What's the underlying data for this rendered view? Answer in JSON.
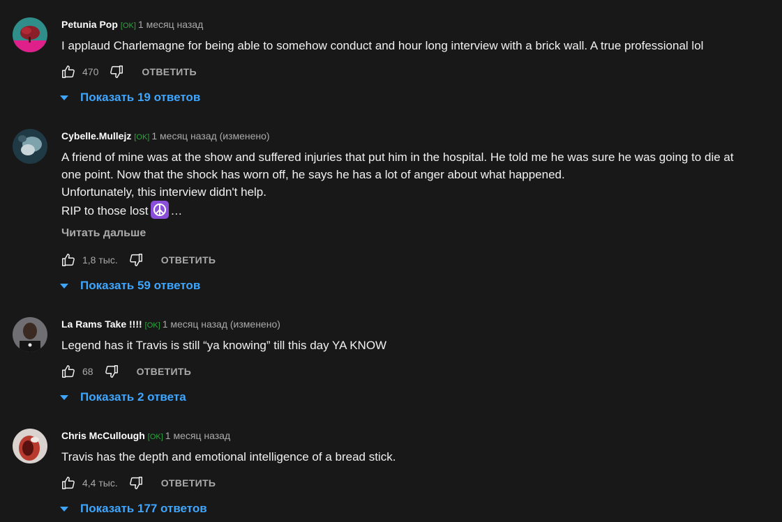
{
  "colors": {
    "background": "#181818",
    "text_primary": "#f1f1f1",
    "text_secondary": "#aaaaaa",
    "link_blue": "#3ea6ff",
    "badge_green": "#2ba640"
  },
  "icons": {
    "like": "thumb-up-icon",
    "dislike": "thumb-down-icon",
    "expand": "caret-down-icon",
    "emoji": "peace-symbol-emoji"
  },
  "comments": [
    {
      "author": "Petunia Pop",
      "badge": "[OK]",
      "timestamp": "1 месяц назад",
      "lines": [
        "I applaud Charlemagne for being able to somehow conduct and hour long interview with a brick wall. A true professional lol"
      ],
      "likes": "470",
      "reply_label": "ОТВЕТИТЬ",
      "show_replies": "Показать 19 ответов"
    },
    {
      "author": "Cybelle.Mullejz",
      "badge": "[OK]",
      "timestamp": "1 месяц назад (изменено)",
      "lines": [
        "A friend of mine was at the show and suffered injuries that put him in the hospital. He told me he was sure he was going to die at",
        "one point. Now that the shock has worn off, he says he has a lot of anger about what happened.",
        "Unfortunately, this interview didn't help.",
        "RIP to those lost"
      ],
      "ellipsis": "…",
      "read_more": "Читать дальше",
      "likes": "1,8 тыс.",
      "reply_label": "ОТВЕТИТЬ",
      "show_replies": "Показать 59 ответов"
    },
    {
      "author": "La Rams Take !!!!",
      "badge": "[OK]",
      "timestamp": "1 месяц назад (изменено)",
      "lines": [
        "Legend has it Travis is still “ya knowing” till this day YA KNOW"
      ],
      "likes": "68",
      "reply_label": "ОТВЕТИТЬ",
      "show_replies": "Показать 2 ответа"
    },
    {
      "author": "Chris McCullough",
      "badge": "[OK]",
      "timestamp": "1 месяц назад",
      "lines": [
        "Travis has the depth and emotional intelligence of a bread stick."
      ],
      "likes": "4,4 тыс.",
      "reply_label": "ОТВЕТИТЬ",
      "show_replies": "Показать 177 ответов"
    }
  ]
}
